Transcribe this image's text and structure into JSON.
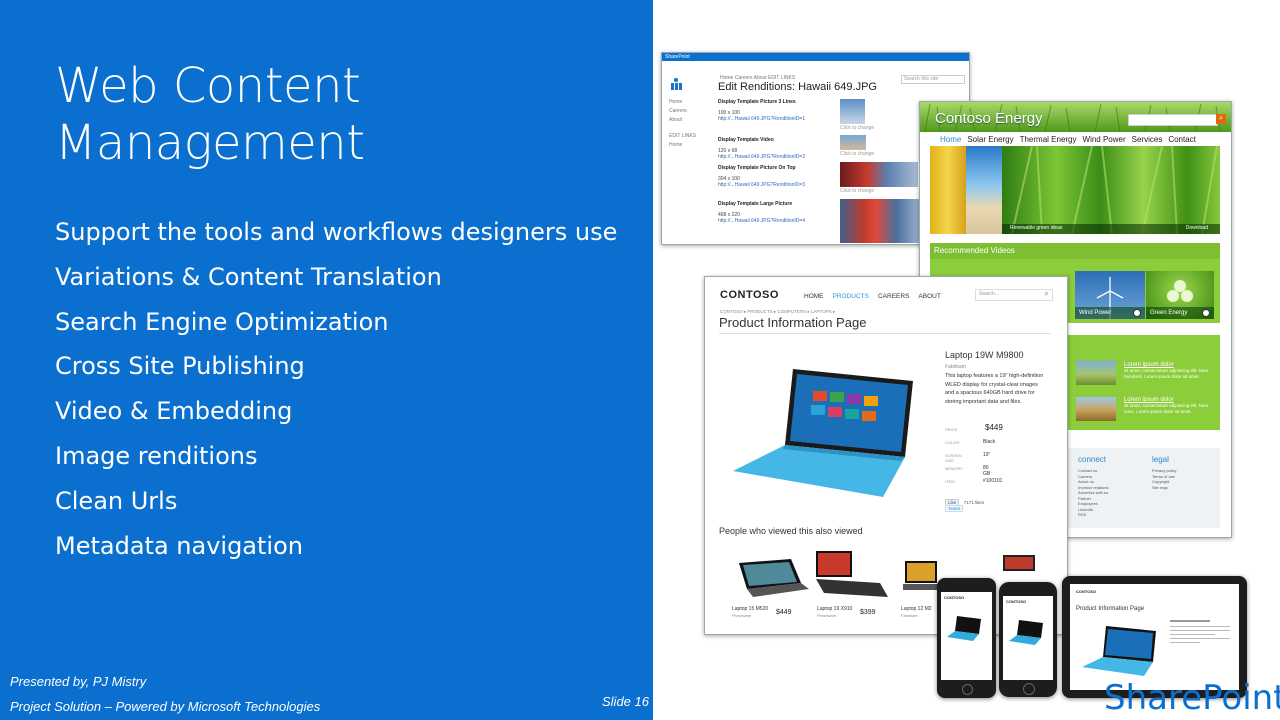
{
  "slide": {
    "title_line1": "Web Content",
    "title_line2": "Management",
    "bullets": [
      "Support the tools and workflows designers use",
      "Variations & Content Translation",
      "Search Engine Optimization",
      "Cross Site Publishing",
      "Video & Embedding",
      "Image renditions",
      "Clean Urls",
      "Metadata navigation"
    ],
    "presenter": "Presented by, PJ Mistry",
    "project": "Project Solution – Powered by Microsoft Technologies",
    "slide_number": "Slide 16",
    "corner_logo": "SharePoint"
  },
  "renditions_screen": {
    "brand": "SharePoint",
    "breadcrumb": "Home  Careers  About  EDIT LINKS",
    "heading": "Edit Renditions: Hawaii 649.JPG",
    "search_placeholder": "Search this site",
    "left_nav": [
      "Home",
      "Careers",
      "About",
      "EDIT LINKS",
      "Home"
    ],
    "rows": [
      {
        "name": "Display Template Picture 3 Lines",
        "size": "100 x 100",
        "link": "http://...Hawaii 649.JPG?RenditionID=1",
        "action": "Click to change"
      },
      {
        "name": "Display Template Video",
        "size": "120 x 68",
        "link": "http://...Hawaii 649.JPG?RenditionID=2",
        "action": "Click to change"
      },
      {
        "name": "Display Template Picture On Top",
        "size": "304 x 100",
        "link": "http://...Hawaii 649.JPG?RenditionID=3",
        "action": "Click to change"
      },
      {
        "name": "Display Template Large Picture",
        "size": "468 x 220",
        "link": "http://...Hawaii 649.JPG?RenditionID=4",
        "action": "Click to change"
      }
    ]
  },
  "energy_screen": {
    "logo": "Contoso Energy",
    "nav": [
      "Home",
      "Solar Energy",
      "Thermal Energy",
      "Wind Power",
      "Services",
      "Contact"
    ],
    "hero_caption": "Renewable green ideas",
    "hero_link": "Download",
    "videos_heading": "Recommended Videos",
    "videos": [
      "Wind Power",
      "Green Energy"
    ],
    "news": [
      {
        "title": "Lorem ipsum dolor",
        "text": "sit amet, consectetuer adipiscing elit. Nam hendrerit. Lorem ipsum dolor sit amet."
      },
      {
        "title": "Lorem ipsum dolor",
        "text": "sit amet, consectetuer adipiscing elit. Nam nunc. Lorem ipsum dolor sit amet."
      }
    ],
    "footer_connect": "connect",
    "footer_legal": "legal",
    "connect_links": [
      "Contact us",
      "Careers",
      "About us",
      "Investor relations",
      "Advertise with us",
      "Partner",
      "Employees",
      "LinkedIn",
      "RSS"
    ],
    "legal_links": [
      "Privacy policy",
      "Terms of use",
      "Copyright",
      "Site map"
    ]
  },
  "product_screen": {
    "logo": "CONTOSO",
    "nav": [
      "HOME",
      "PRODUCTS",
      "CAREERS",
      "ABOUT"
    ],
    "search_placeholder": "Search...",
    "breadcrumb": "CONTOSO ▸ PRODUCTS ▸ COMPUTERS ▸ LAPTOPS ▸",
    "page_title": "Product Information Page",
    "product_name": "Laptop 19W M9800",
    "brand": "Fabrikam",
    "description": "This laptop features a 19\" high-definition WLED display for crystal-clear images and a spacious 640GB hard drive for storing important data and files.",
    "specs": [
      {
        "label": "PRICE",
        "value": "$449"
      },
      {
        "label": "COLOR",
        "value": "Black"
      },
      {
        "label": "SCREEN SIZE",
        "value": "19\""
      },
      {
        "label": "MEMORY",
        "value": "80 GB"
      },
      {
        "label": "ITEM",
        "value": "#100101"
      }
    ],
    "like_label": "Like",
    "like_count": "7171 likes",
    "tweet_label": "Tweet",
    "also_viewed_heading": "People who viewed this also viewed",
    "also_viewed": [
      {
        "name": "Laptop 15 M520",
        "brand": "Proseware",
        "price": "$449"
      },
      {
        "name": "Laptop 19 X910",
        "brand": "Proseware",
        "price": "$399"
      },
      {
        "name": "Laptop 12 M2",
        "brand": "Fabrikam",
        "price": ""
      }
    ]
  },
  "devices": {
    "phone_logo": "CONTOSO",
    "tablet_title": "Product Information Page"
  },
  "colors": {
    "slide_blue": "#0a6fce",
    "energy_green": "#7dbe32",
    "link_blue": "#2a6ebb",
    "tablet_cyan": "#33aadd"
  }
}
